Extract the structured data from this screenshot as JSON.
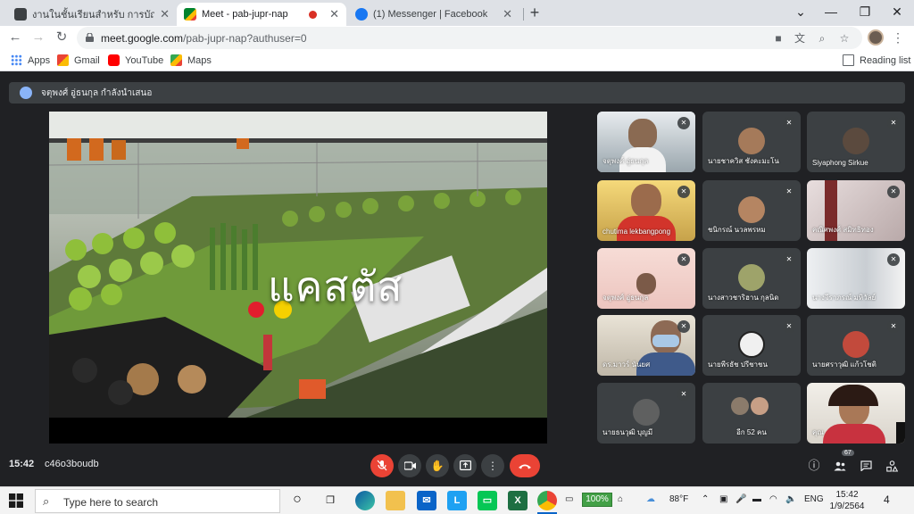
{
  "browser": {
    "tabs": [
      {
        "title": "งานในชั้นเรียนสำหรับ การบัญชีร่วมค้า",
        "icon": "classroom-icon"
      },
      {
        "title": "Meet - pab-jupr-nap",
        "icon": "meet-icon",
        "recording": true
      },
      {
        "title": "(1) Messenger | Facebook",
        "icon": "messenger-icon"
      }
    ],
    "new_tab": "+",
    "url_host": "meet.google.com",
    "url_path": "/pab-jupr-nap?authuser=0",
    "bookmarks": [
      "Apps",
      "Gmail",
      "YouTube",
      "Maps"
    ],
    "reading_list": "Reading list"
  },
  "meet": {
    "presenter_text": "จตุพงศ์ อู่ธนกุล กำลังนำเสนอ",
    "slide_title": "แคสตัส",
    "participants": [
      {
        "name": "จตุพงศ์ อู่ธนกุล"
      },
      {
        "name": "นายชาควิส ชังคะมะโน"
      },
      {
        "name": "Siyaphong Sirkue"
      },
      {
        "name": "chutima lekbangpong"
      },
      {
        "name": "ชนิกรณ์ นวลพรหม"
      },
      {
        "name": "คณิศพงศ์ สมิทธิทอง"
      },
      {
        "name": "จตุพงศ์ อู่ธนกุล"
      },
      {
        "name": "นางสาวชาริฮาน กุลนิด"
      },
      {
        "name": "นางจีราภรณ์ มหิวัลย์"
      },
      {
        "name": "ดร.มาวร์ นันยศ"
      },
      {
        "name": "นายพีรธัช ปรีชาชน"
      },
      {
        "name": "นายศราวุฒิ แก้วโชติ"
      },
      {
        "name": "นายธนวุฒิ บุญมี"
      },
      {
        "name": "อีก 52 คน"
      },
      {
        "name": "คุณ"
      }
    ],
    "time": "15:42",
    "meeting_code": "c46o3boudb",
    "participants_count": "67"
  },
  "taskbar": {
    "search_placeholder": "Type here to search",
    "battery": "100%",
    "weather": "88°F",
    "lang": "ENG",
    "time": "15:42",
    "date": "1/9/2564",
    "notifications": "4"
  }
}
